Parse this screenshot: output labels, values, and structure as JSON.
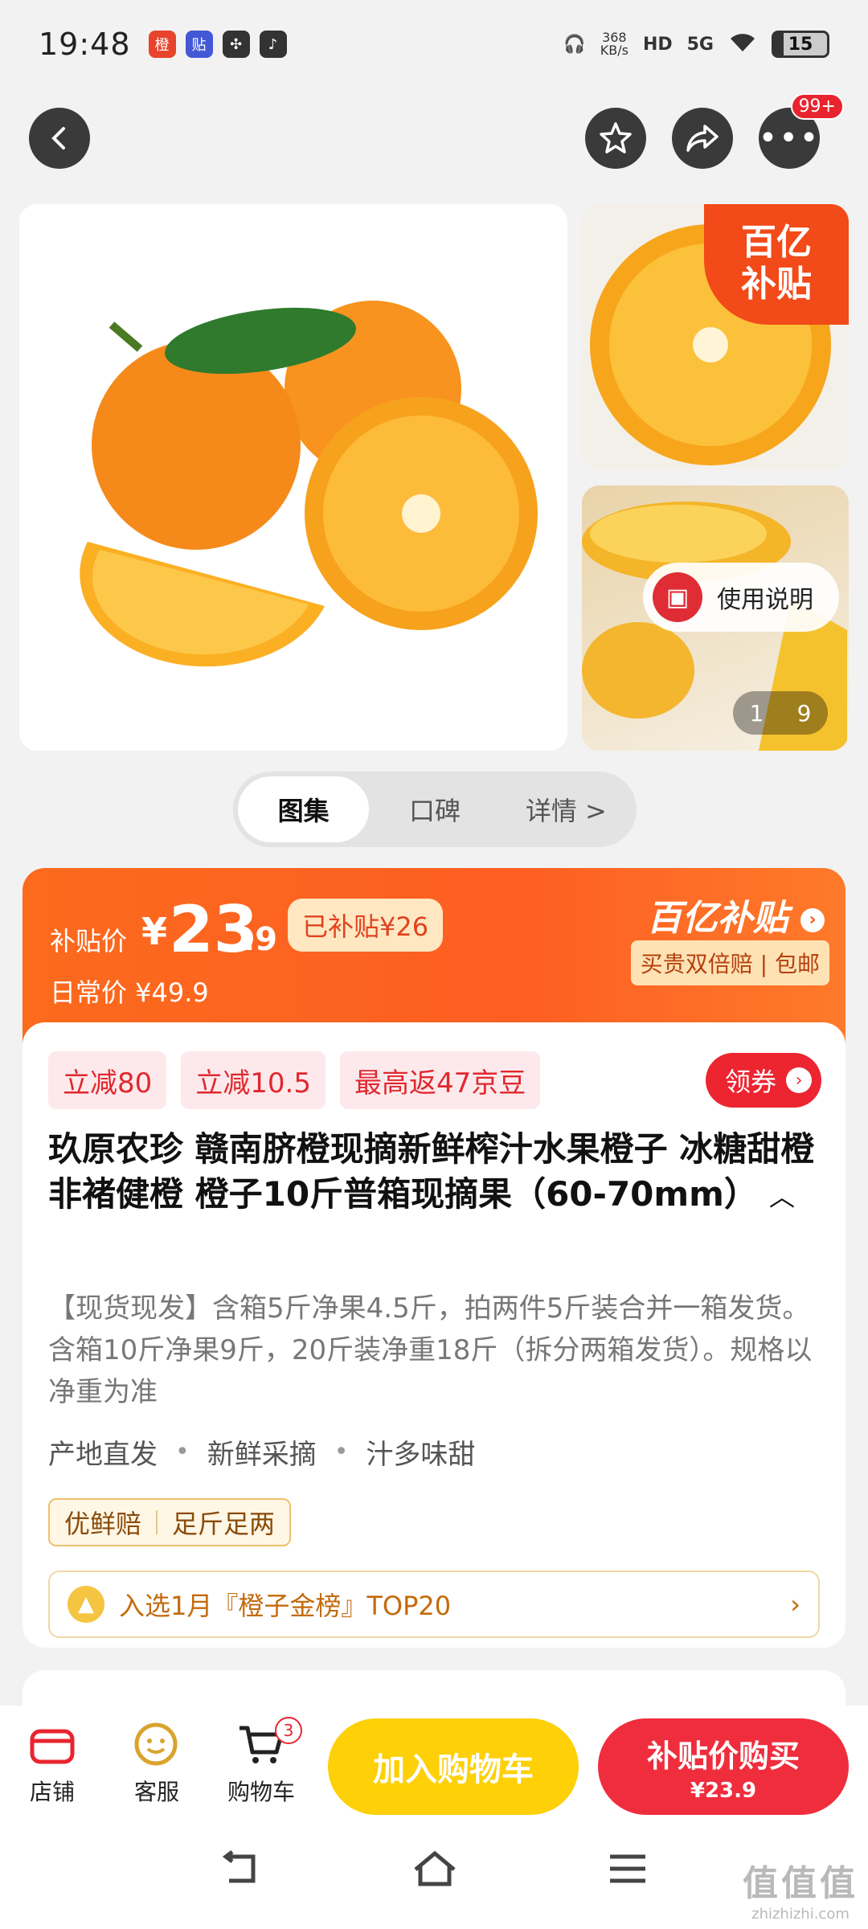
{
  "status_bar": {
    "time": "19:48",
    "apps": [
      "app-icon-red",
      "app-icon-blue",
      "app-icon-fan",
      "app-icon-tiktok"
    ],
    "net_speed_value": "368",
    "net_speed_unit": "KB/s",
    "hd": "HD",
    "signal": "5G",
    "battery": "15"
  },
  "top_nav": {
    "back_icon": "back-arrow-icon",
    "favorite_icon": "star-icon",
    "share_icon": "share-icon",
    "more_icon": "more-icon",
    "more_badge": "99+"
  },
  "gallery": {
    "main_image": "orange-main-image",
    "thumb1": "orange-half-thumb",
    "thumb2": "orange-slice-thumb",
    "subsidy_corner": "百亿\n补贴",
    "usage_label": "使用说明",
    "pager_current": "1",
    "pager_total": "9"
  },
  "tabs": [
    {
      "label": "图集",
      "active": true
    },
    {
      "label": "口碑",
      "active": false
    },
    {
      "label": "详情 >",
      "active": false
    }
  ],
  "price": {
    "label": "补贴价",
    "currency": "¥",
    "integer": "23",
    "decimal": ".9",
    "subsidized": "已补贴¥26",
    "regular": "日常价 ¥49.9",
    "brand": "百亿补贴",
    "guarantee": "买贵双倍赔 | 包邮"
  },
  "tags": [
    "立减80",
    "立减10.5",
    "最高返47京豆"
  ],
  "coupon_label": "领券",
  "product": {
    "title": "玖原农珍 赣南脐橙现摘新鲜榨汁水果橙子 冰糖甜橙非褚健橙 橙子10斤普箱现摘果（60-70mm）",
    "description": "【现货现发】含箱5斤净果4.5斤，拍两件5斤装合并一箱发货。含箱10斤净果9斤，20斤装净重18斤（拆分两箱发货）。规格以净重为准",
    "features": [
      "产地直发",
      "新鲜采摘",
      "汁多味甜"
    ],
    "promises": [
      "优鲜赔",
      "足斤足两"
    ],
    "rank": "入选1月『橙子金榜』TOP20"
  },
  "action_bar": {
    "store": "店铺",
    "service": "客服",
    "cart": "购物车",
    "cart_count": "3",
    "add_to_cart": "加入购物车",
    "buy_line1": "补贴价购买",
    "buy_line2": "¥23.9"
  },
  "watermark": {
    "line1": "值值值",
    "line2": "zhizhizhi.com"
  }
}
